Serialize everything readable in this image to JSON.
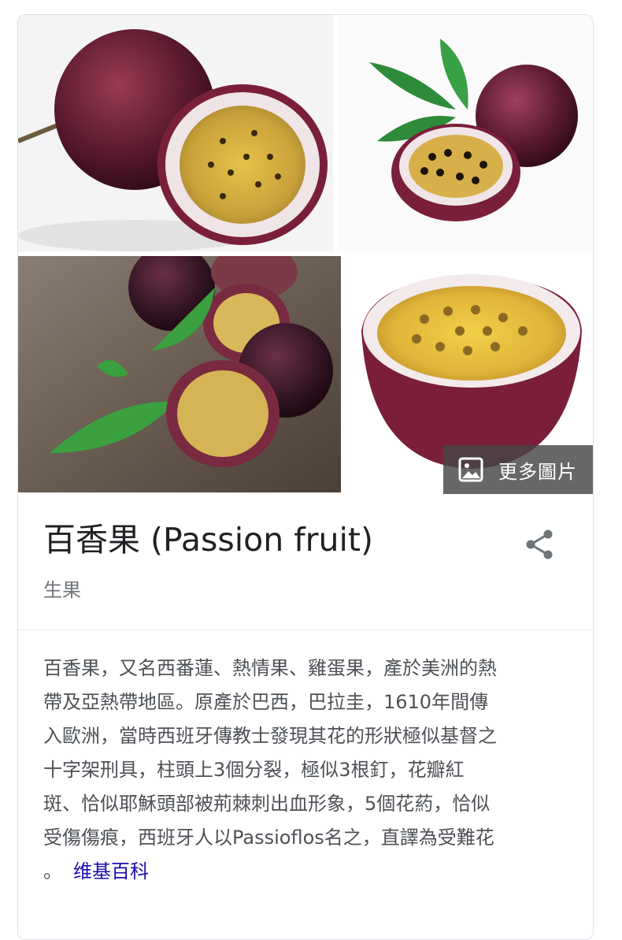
{
  "knowledge_panel": {
    "images": [
      {
        "label": "passion-fruit-halved-image"
      },
      {
        "label": "passion-fruit-with-leaves-image"
      },
      {
        "label": "passion-fruit-on-wood-image"
      },
      {
        "label": "passion-fruit-half-closeup-image"
      }
    ],
    "more_images_label": "更多圖片",
    "title": "百香果 (Passion fruit)",
    "subtitle": "生果",
    "description_lines": [
      "百香果，又名西番蓮、熱情果、雞蛋果，產於美洲的熱",
      "帶及亞熱帶地區。原產於巴西，巴拉圭，1610年間傳",
      "入歐洲，當時西班牙傳教士發現其花的形狀極似基督之",
      "十字架刑具，柱頭上3個分裂，極似3根釘，花瓣紅",
      "斑、恰似耶穌頭部被荊棘刺出血形象，5個花葯，恰似",
      "受傷傷痕，西班牙人以Passioflos名之，直譯為受難花",
      "。"
    ],
    "source_link": "维基百科",
    "icons": {
      "more_images": "image-icon",
      "share": "share-icon"
    },
    "colors": {
      "title": "#202124",
      "subtitle": "#70757a",
      "body": "#4d5156",
      "link": "#1a0dab",
      "overlay": "#464646"
    }
  }
}
